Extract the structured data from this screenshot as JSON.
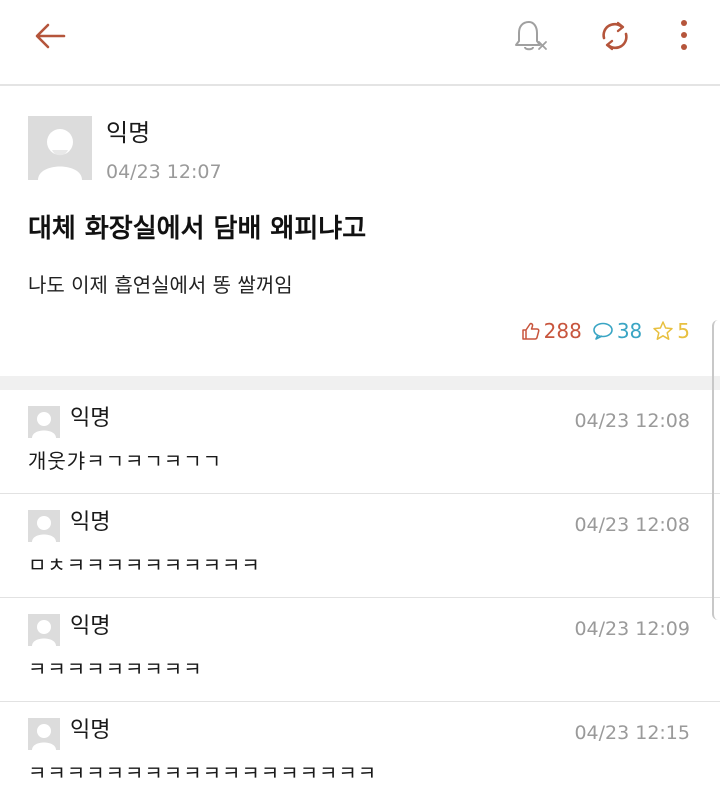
{
  "topbar": {
    "icons": [
      "arrow-left-icon",
      "bell-off-icon",
      "refresh-icon",
      "more-vertical-icon"
    ],
    "accent_color": "#b5553b"
  },
  "post": {
    "author": "익명",
    "timestamp": "04/23 12:07",
    "title": "대체 화장실에서 담배 왜피냐고",
    "body": "나도 이제 흡연실에서 똥 쌀꺼임",
    "likes": "288",
    "comments": "38",
    "scraps": "5",
    "colors": {
      "like": "#c8553d",
      "comment": "#39a5c4",
      "scrap": "#e8c040"
    }
  },
  "comments": [
    {
      "author": "익명",
      "timestamp": "04/23 12:08",
      "text": "개웃갸ㅋㄱㅋㄱㅋㄱㄱ"
    },
    {
      "author": "익명",
      "timestamp": "04/23 12:08",
      "text": "ㅁㅊㅋㅋㅋㅋㅋㅋㅋㅋㅋㅋ"
    },
    {
      "author": "익명",
      "timestamp": "04/23 12:09",
      "text": "ㅋㅋㅋㅋㅋㅋㅋㅋㅋ"
    },
    {
      "author": "익명",
      "timestamp": "04/23 12:15",
      "text": "ㅋㅋㅋㅋㅋㅋㅋㅋㅋㅋㅋㅋㅋㅋㅋㅋㅋㅋ"
    }
  ]
}
